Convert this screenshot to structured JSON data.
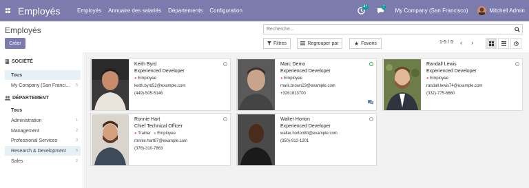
{
  "navbar": {
    "brand": "Employés",
    "menu": [
      "Employés",
      "Annuaire des salariés",
      "Départements",
      "Configuration"
    ],
    "activity_count": "47",
    "message_count": "7",
    "company": "My Company (San Francisco)",
    "user": "Mitchell Admin",
    "bg_color": "#7c7bad"
  },
  "control": {
    "title": "Employés",
    "create_label": "Créer",
    "search_placeholder": "Recherche...",
    "filters_label": "Filtres",
    "group_label": "Regrouper par",
    "favorites_label": "Favoris",
    "pager": "1-5 / 5"
  },
  "sidebar": {
    "company_header": "SOCIÉTÉ",
    "company_items": [
      {
        "label": "Tous",
        "count": ""
      },
      {
        "label": "My Company (San Franci...",
        "count": "5"
      }
    ],
    "department_header": "DÉPARTEMENT",
    "department_items": [
      {
        "label": "Tous",
        "count": ""
      },
      {
        "label": "Administration",
        "count": "1"
      },
      {
        "label": "Management",
        "count": "2"
      },
      {
        "label": "Professional Services",
        "count": "3"
      },
      {
        "label": "Research & Development",
        "count": "5"
      },
      {
        "label": "Sales",
        "count": "2"
      }
    ]
  },
  "employees": [
    {
      "name": "Keith Byrd",
      "job": "Experienced Developer",
      "tags": [
        "Employee"
      ],
      "email": "keith.byrd52@example.com",
      "phone": "(449)-505-5146",
      "status": "away",
      "has_chat": false
    },
    {
      "name": "Marc Demo",
      "job": "Experienced Developer",
      "tags": [
        "Employee"
      ],
      "email": "mark.brown23@example.com",
      "phone": "+3281813700",
      "status": "online",
      "has_chat": true
    },
    {
      "name": "Randall Lewis",
      "job": "Experienced Developer",
      "tags": [
        "Employee"
      ],
      "email": "randall.lewis74@example.com",
      "phone": "(332)-775-6660",
      "status": "away",
      "has_chat": false
    },
    {
      "name": "Ronnie Hart",
      "job": "Chief Technical Officer",
      "tags": [
        "Trainer",
        "Employee"
      ],
      "email": "ronnie.hart87@example.com",
      "phone": "(376)-310-7863",
      "status": "away",
      "has_chat": false
    },
    {
      "name": "Walter Horton",
      "job": "Experienced Developer",
      "tags": [],
      "email": "walter.horton80@example.com",
      "phone": "(350)-912-1201",
      "status": "away",
      "has_chat": false
    }
  ]
}
